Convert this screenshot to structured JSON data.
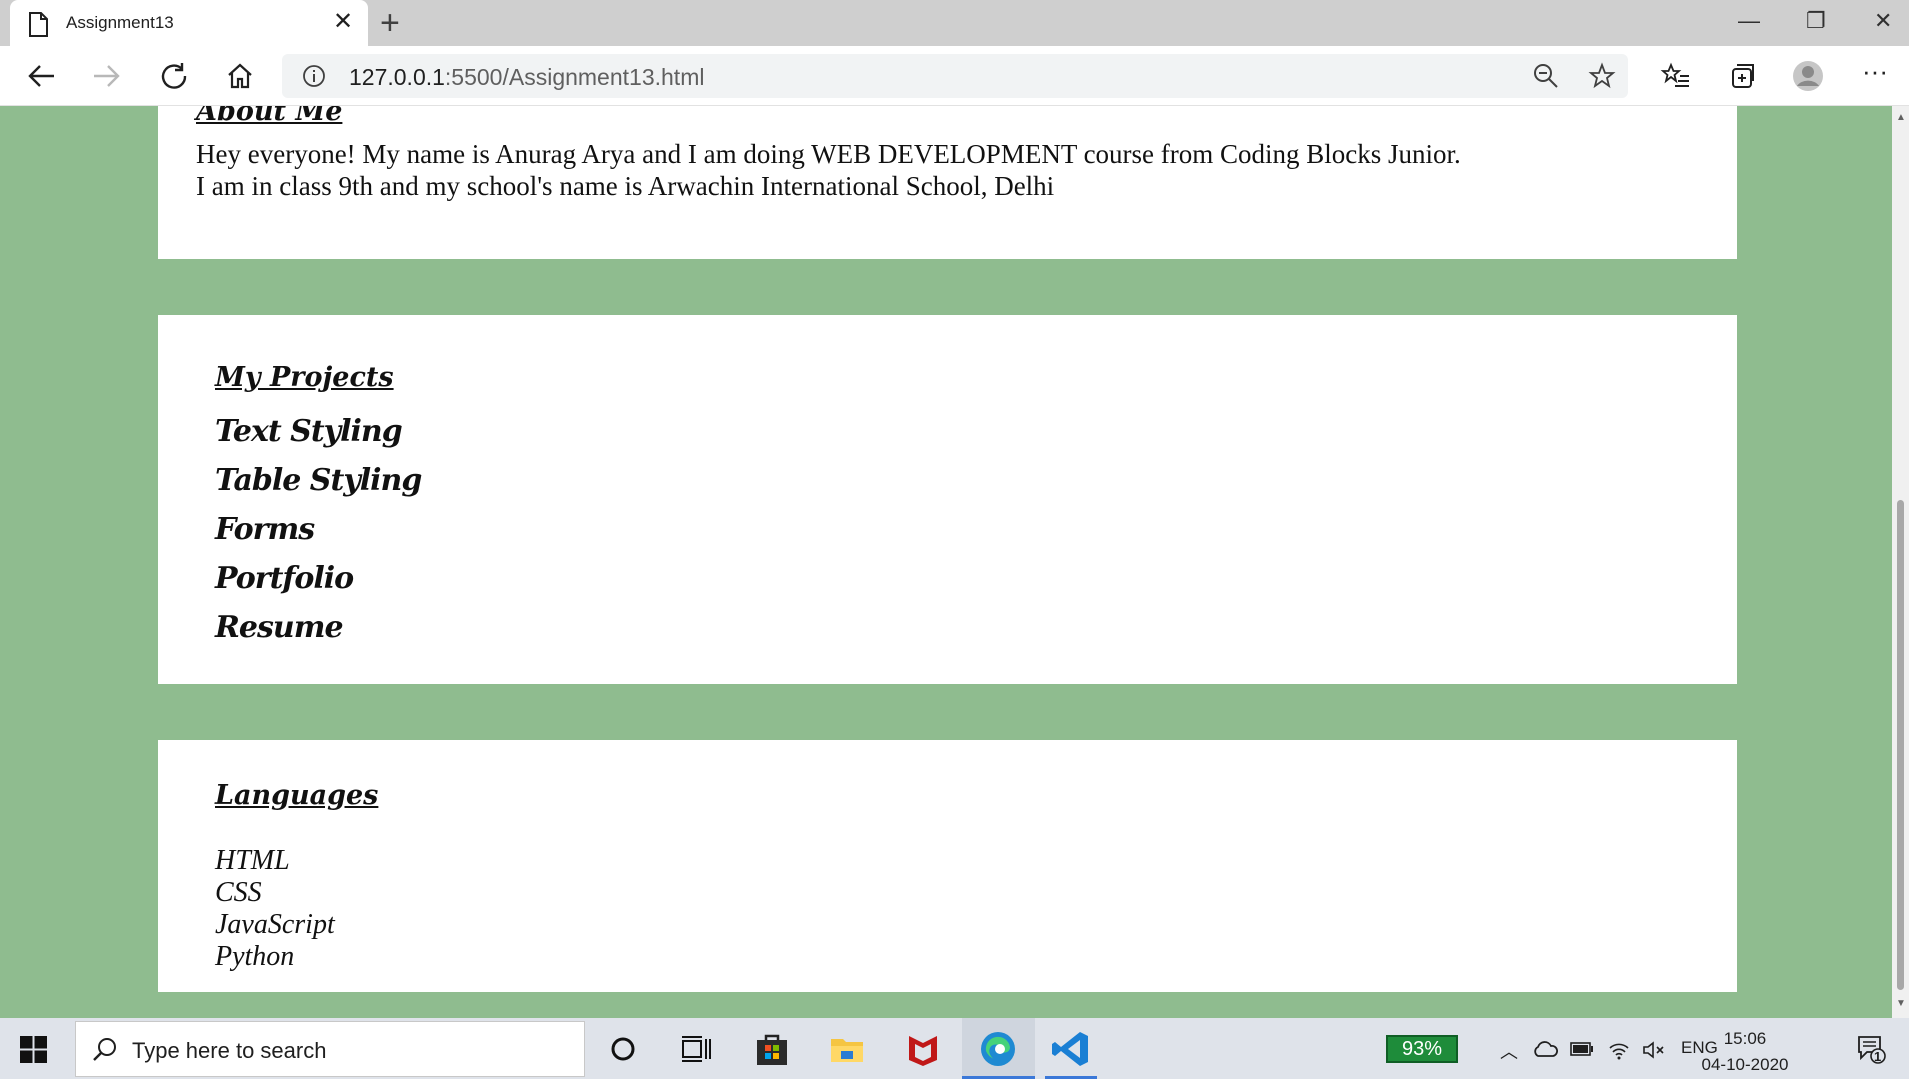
{
  "browser": {
    "tab_title": "Assignment13",
    "url_host": "127.0.0.1",
    "url_rest": ":5500/Assignment13.html"
  },
  "about": {
    "heading": "About Me",
    "line1": "Hey everyone! My name is Anurag Arya and I am doing WEB DEVELOPMENT course from Coding Blocks Junior.",
    "line2": "I am in class 9th and my school's name is Arwachin International School, Delhi"
  },
  "projects": {
    "heading": "My Projects",
    "items": [
      "Text Styling",
      "Table Styling",
      "Forms",
      "Portfolio",
      "Resume"
    ]
  },
  "languages": {
    "heading": "Languages",
    "items": [
      "HTML",
      "CSS",
      "JavaScript",
      "Python"
    ]
  },
  "taskbar": {
    "search_placeholder": "Type here to search",
    "battery": "93%",
    "language": "ENG",
    "time": "15:06",
    "date": "04-10-2020",
    "notifications": "1"
  },
  "colors": {
    "page_background": "#8fbc8f",
    "card_background": "#ffffff",
    "battery_green": "#1e8c3a"
  }
}
